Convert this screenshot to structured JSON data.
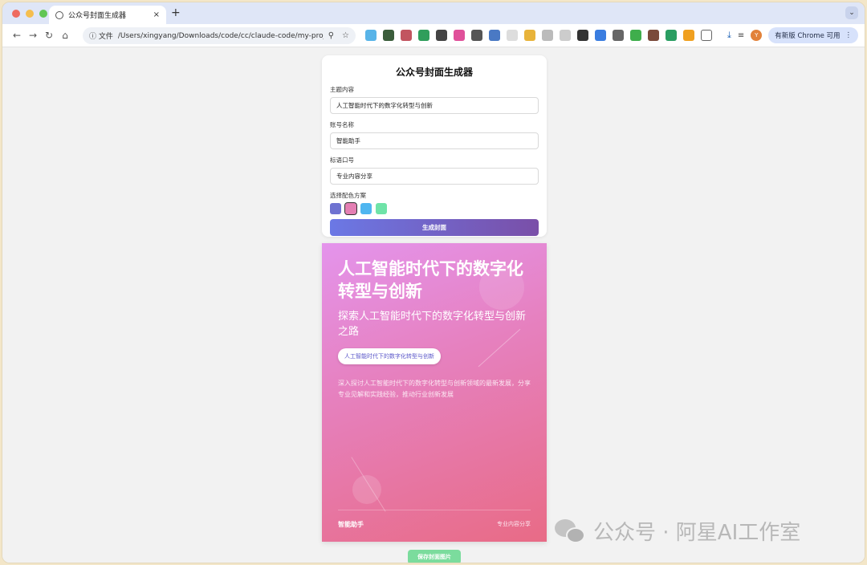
{
  "browser": {
    "tab_title": "公众号封面生成器",
    "tab_close": "×",
    "new_tab": "+",
    "file_label": "ⓘ 文件",
    "url": "/Users/xingyang/Downloads/code/cc/claude-code/my-proje...",
    "update_label": "有新版 Chrome 可用",
    "avatar_letter": "Y"
  },
  "form": {
    "title": "公众号封面生成器",
    "topic_label": "主题内容",
    "topic_value": "人工智能时代下的数字化转型与创新",
    "account_label": "账号名称",
    "account_value": "智能助手",
    "slogan_label": "标语口号",
    "slogan_value": "专业内容分享",
    "color_label": "选择配色方案",
    "swatch_colors": [
      "#6f73d1",
      "#e47fb3",
      "#4fb6f0",
      "#6fe3a8"
    ],
    "selected_swatch": 1,
    "generate_label": "生成封面"
  },
  "cover": {
    "title": "人工智能时代下的数字化转型与创新",
    "subtitle": "探索人工智能时代下的数字化转型与创新之路",
    "tag": "人工智能时代下的数字化转型与创新",
    "description": "深入探讨人工智能时代下的数字化转型与创新领域的最新发展，分享专业见解和实践经验，推动行业创新发展",
    "account": "智能助手",
    "slogan": "专业内容分享"
  },
  "save_label": "保存封面图片",
  "watermark": "公众号 · 阿星AI工作室"
}
